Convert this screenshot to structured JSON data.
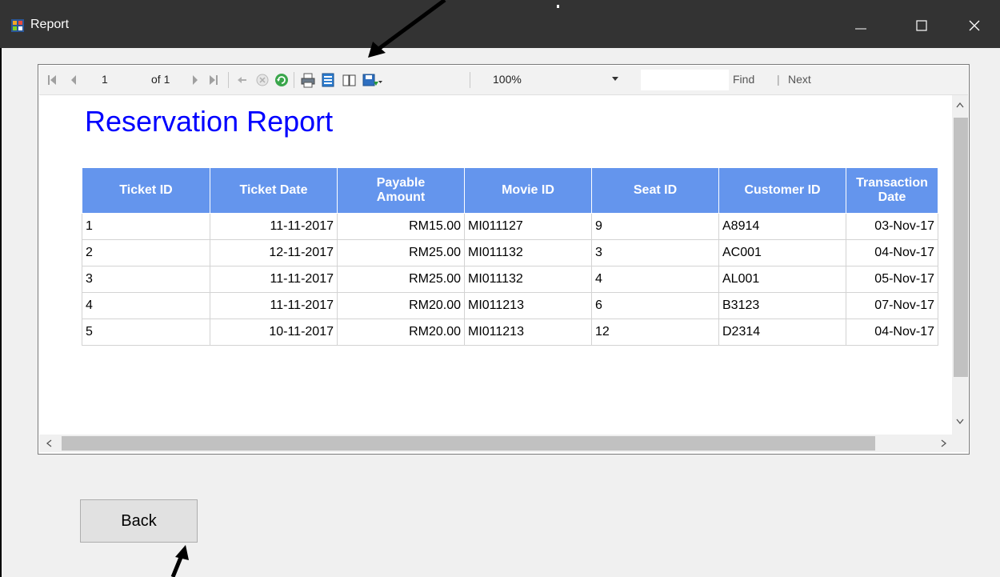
{
  "window": {
    "title": "Report",
    "icon": "report-app-icon",
    "controls": [
      "minimize-icon",
      "maximize-icon",
      "close-icon"
    ]
  },
  "toolbar": {
    "current_page": "1",
    "of_label": "of 1",
    "zoom": "100%",
    "find_label": "Find",
    "find_separator": "|",
    "next_label": "Next",
    "icons": [
      "first-page-icon",
      "previous-page-icon",
      "next-page-icon",
      "last-page-icon",
      "back-to-parent-icon",
      "stop-icon",
      "refresh-icon",
      "print-icon",
      "print-layout-icon",
      "page-setup-icon",
      "export-icon"
    ]
  },
  "report": {
    "title": "Reservation Report",
    "columns": [
      {
        "line1": "Ticket ID",
        "line2": ""
      },
      {
        "line1": "Ticket Date",
        "line2": ""
      },
      {
        "line1": "Payable",
        "line2": "Amount"
      },
      {
        "line1": "Movie ID",
        "line2": ""
      },
      {
        "line1": "Seat ID",
        "line2": ""
      },
      {
        "line1": "Customer ID",
        "line2": ""
      },
      {
        "line1": "Transaction",
        "line2": "Date"
      }
    ],
    "rows": [
      [
        "1",
        "11-11-2017",
        "RM15.00",
        "MI011127",
        "9",
        "A8914",
        "03-Nov-17"
      ],
      [
        "2",
        "12-11-2017",
        "RM25.00",
        "MI011132",
        "3",
        "AC001",
        "04-Nov-17"
      ],
      [
        "3",
        "11-11-2017",
        "RM25.00",
        "MI011132",
        "4",
        "AL001",
        "05-Nov-17"
      ],
      [
        "4",
        "11-11-2017",
        "RM20.00",
        "MI011213",
        "6",
        "B3123",
        "07-Nov-17"
      ],
      [
        "5",
        "10-11-2017",
        "RM20.00",
        "MI011213",
        "12",
        "D2314",
        "04-Nov-17"
      ]
    ]
  },
  "back_button": {
    "label": "Back"
  },
  "colors": {
    "titlebar": "#333333",
    "report_title": "#0000ff",
    "table_header": "#6495ed",
    "annotation_arrow": "#000000"
  }
}
